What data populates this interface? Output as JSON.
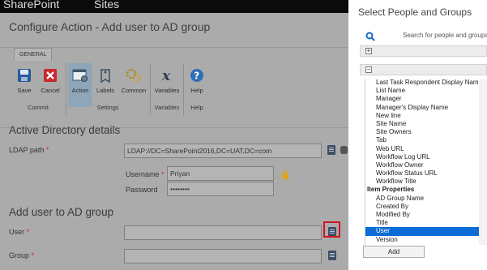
{
  "suite_bar": {
    "app_name": "SharePoint",
    "sites_link": "Sites"
  },
  "dialog": {
    "title": "Configure Action - Add user to AD group"
  },
  "ribbon": {
    "tab": "GENERAL",
    "buttons": [
      {
        "label": "Save",
        "icon": "save-icon"
      },
      {
        "label": "Cancel",
        "icon": "cancel-icon"
      },
      {
        "label": "Action",
        "icon": "action-icon"
      },
      {
        "label": "Labels",
        "icon": "labels-icon"
      },
      {
        "label": "Common",
        "icon": "common-icon"
      },
      {
        "label": "Variables",
        "icon": "variables-icon"
      },
      {
        "label": "Help",
        "icon": "help-icon"
      }
    ],
    "groups": [
      "Commit",
      "Settings",
      "Variables",
      "Help"
    ]
  },
  "ad_details": {
    "heading": "Active Directory details",
    "ldap_label": "LDAP path",
    "ldap_value": "LDAP://DC=SharePoint2016,DC=UAT,DC=com",
    "username_label": "Username",
    "username_value": "Priyan",
    "password_label": "Password",
    "password_value": "••••••••"
  },
  "add_user": {
    "heading": "Add user to AD group",
    "user_label": "User",
    "group_label": "Group",
    "required_mark": "*"
  },
  "picker": {
    "title": "Select People and Groups",
    "search_placeholder": "Search for people and groups",
    "items": [
      "Last Task Respondent Display Name",
      "List Name",
      "Manager",
      "Manager's Display Name",
      "New line",
      "Site Name",
      "Site Owners",
      "Tab",
      "Web URL",
      "Workflow Log URL",
      "Workflow Owner",
      "Workflow Status URL",
      "Workflow Title"
    ],
    "item_properties_header": "Item Properties",
    "property_items": [
      "AD Group Name",
      "Created By",
      "Modified By",
      "Title",
      "User",
      "Version"
    ],
    "selected_item": "User",
    "add_button": "Add"
  },
  "colors": {
    "accent": "#0a6cd4",
    "highlight_box": "#d2131c"
  }
}
